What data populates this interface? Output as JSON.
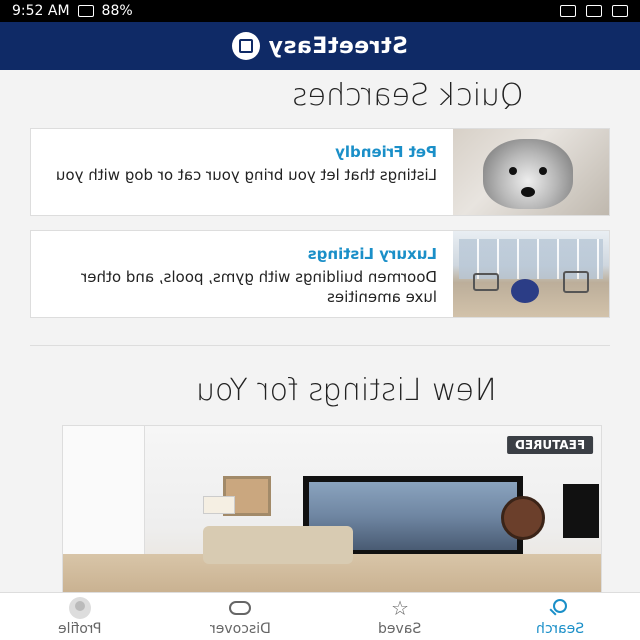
{
  "status_bar": {
    "time": "9:52 AM",
    "battery": "88%"
  },
  "appbar": {
    "brand": "StreetEasy"
  },
  "quick_searches": {
    "title": "Quick Searches",
    "cards": [
      {
        "title": "Pet Friendly",
        "description": "Listings that let you bring your cat or dog with you",
        "image_icon": "dog-photo"
      },
      {
        "title": "Luxury Listings",
        "description": "Doormen buildings with gyms, pools, and other luxe amenities",
        "image_icon": "gym-photo"
      }
    ]
  },
  "new_listings": {
    "title": "New Listings for You",
    "featured_badge": "FEATURED"
  },
  "bottom_nav": {
    "items": [
      {
        "label": "Profile",
        "icon": "user-icon"
      },
      {
        "label": "Discover",
        "icon": "binoculars-icon"
      },
      {
        "label": "Saved",
        "icon": "star-icon"
      },
      {
        "label": "Search",
        "icon": "search-icon"
      }
    ],
    "active": "Search"
  },
  "colors": {
    "appbar": "#0f2a66",
    "accent": "#1a8fc8"
  }
}
